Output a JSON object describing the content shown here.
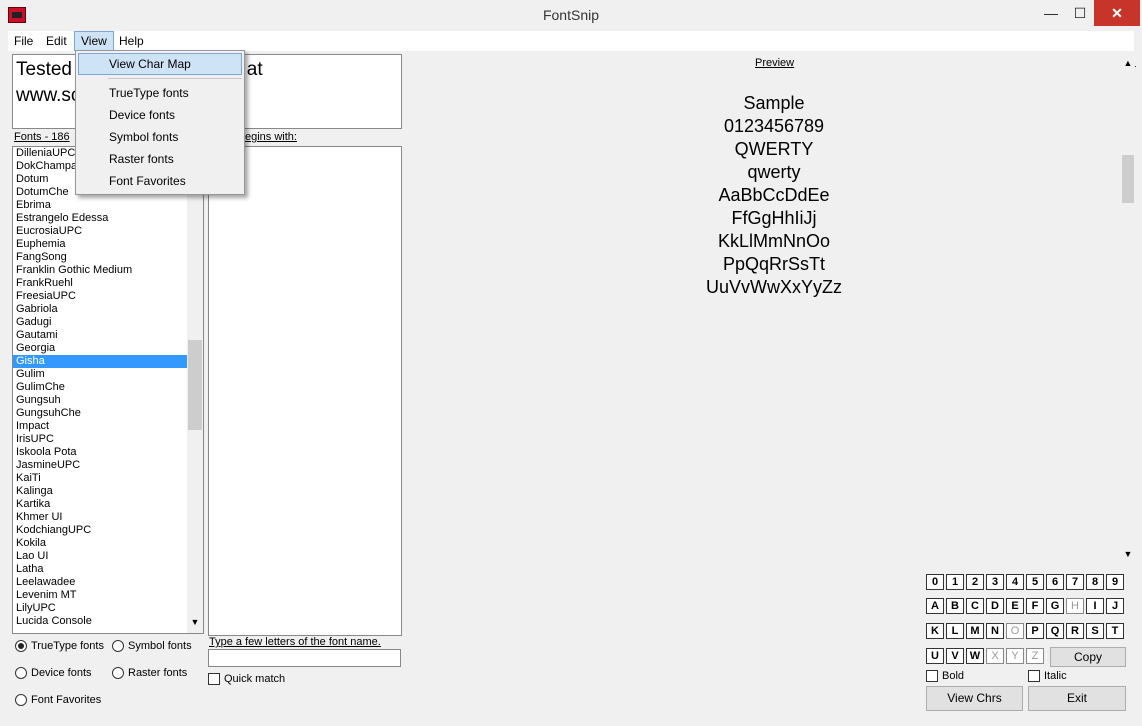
{
  "window": {
    "title": "FontSnip",
    "minimize": "—",
    "maximize": "☐",
    "close": "✕"
  },
  "menu": [
    "File",
    "Edit",
    "View",
    "Help"
  ],
  "view_menu": {
    "items": [
      "View Char Map",
      "TrueType fonts",
      "Device fonts",
      "Symbol fonts",
      "Raster fonts",
      "Font Favorites"
    ]
  },
  "sample_text": {
    "line1": "Tested",
    "line1_end": "s at",
    "line2": "www.sc"
  },
  "fonts_label": "Fonts - 186",
  "begins_label": "egins with:",
  "fonts": [
    "DilleniaUPC",
    "DokChampa",
    "Dotum",
    "DotumChe",
    "Ebrima",
    "Estrangelo Edessa",
    "EucrosiaUPC",
    "Euphemia",
    "FangSong",
    "Franklin Gothic Medium",
    "FrankRuehl",
    "FreesiaUPC",
    "Gabriola",
    "Gadugi",
    "Gautami",
    "Georgia",
    "Gisha",
    "Gulim",
    "GulimChe",
    "Gungsuh",
    "GungsuhChe",
    "Impact",
    "IrisUPC",
    "Iskoola Pota",
    "JasmineUPC",
    "KaiTi",
    "Kalinga",
    "Kartika",
    "Khmer UI",
    "KodchiangUPC",
    "Kokila",
    "Lao UI",
    "Latha",
    "Leelawadee",
    "Levenim MT",
    "LilyUPC",
    "Lucida Console"
  ],
  "selected_font": "Gisha",
  "radios": {
    "truetype": "TrueType fonts",
    "symbol": "Symbol fonts",
    "device": "Device fonts",
    "raster": "Raster fonts",
    "favorites": "Font Favorites"
  },
  "type_hint": "Type a few letters of the font name.",
  "quick_match": "Quick match",
  "preview": {
    "title": "Preview",
    "size": "14",
    "lines": [
      "Sample",
      "0123456789",
      "QWERTY",
      "qwerty",
      "AaBbCcDdEe",
      "FfGgHhIiJj",
      "KkLlMmNnOo",
      "PpQqRrSsTt",
      "UuVvWwXxYyZz"
    ]
  },
  "keys": {
    "row1": [
      "0",
      "1",
      "2",
      "3",
      "4",
      "5",
      "6",
      "7",
      "8",
      "9"
    ],
    "row2": [
      "A",
      "B",
      "C",
      "D",
      "E",
      "F",
      "G",
      "H",
      "I",
      "J"
    ],
    "row3": [
      "K",
      "L",
      "M",
      "N",
      "O",
      "P",
      "Q",
      "R",
      "S",
      "T"
    ],
    "row4": [
      "U",
      "V",
      "W",
      "X",
      "Y",
      "Z"
    ]
  },
  "bold": "Bold",
  "italic": "Italic",
  "copy_button": "Copy",
  "view_chrs_button": "View Chrs",
  "exit_button": "Exit",
  "colors": {
    "selection": "#3399ff",
    "close": "#c7352a",
    "menu_highlight": "#cfe3f7"
  }
}
